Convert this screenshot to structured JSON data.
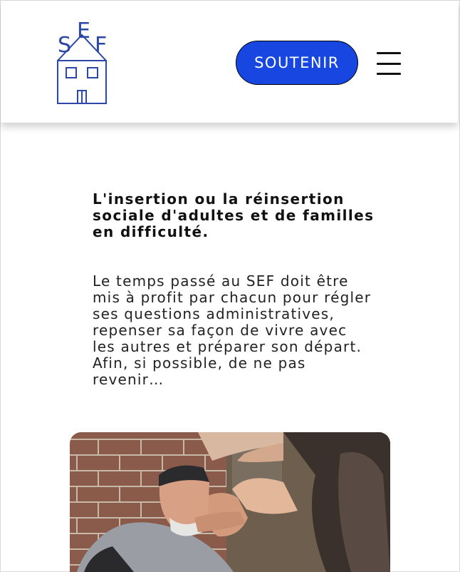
{
  "header": {
    "logo": {
      "letters": [
        "S",
        "E",
        "F"
      ]
    },
    "cta_label": "SOUTENIR",
    "menu_icon": "hamburger-icon"
  },
  "main": {
    "headline": "L'insertion ou la réinsertion sociale d'adultes et de familles en difficulté.",
    "body": "Le temps passé au SEF doit être mis à profit par chacun pour régler ses questions administratives, repenser sa façon de vivre avec les autres et préparer son départ. Afin, si possible, de ne pas revenir…"
  },
  "colors": {
    "accent": "#1747e0",
    "logo": "#2b47a8",
    "text": "#111111"
  }
}
